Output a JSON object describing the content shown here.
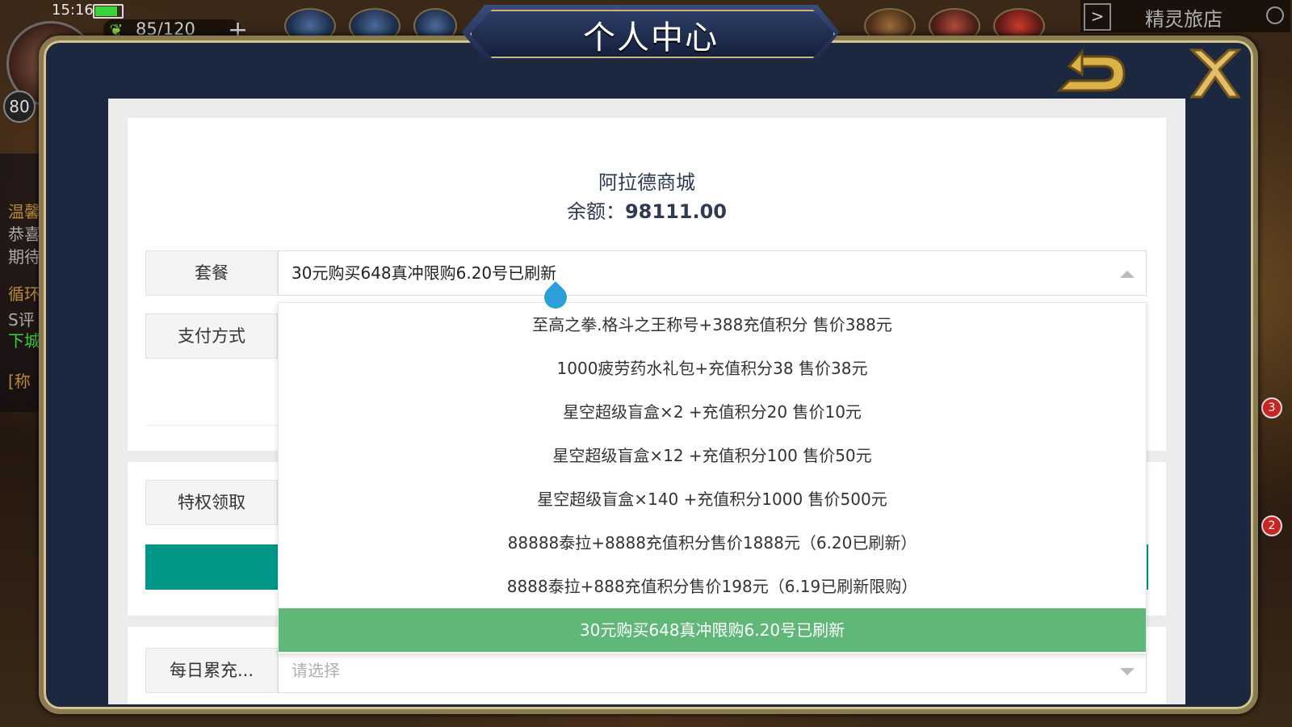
{
  "status_bar": {
    "time": "15:16",
    "energy": "85/120",
    "level": "80"
  },
  "top_right": {
    "shop_label": "精灵旅店"
  },
  "side_panel": {
    "lines": [
      "温馨",
      "恭喜",
      "期待",
      "循环",
      "S评",
      "下城",
      "[称"
    ]
  },
  "badges": [
    "3",
    "2"
  ],
  "modal": {
    "title": "个人中心",
    "shop_name": "阿拉德商城",
    "balance_label": "余额：",
    "balance_value": "98111.00"
  },
  "form": {
    "package_label": "套餐",
    "package_value": "30元购买648真冲限购6.20号已刷新",
    "payment_label": "支付方式",
    "privilege_label": "特权领取",
    "daily_label": "每日累充...",
    "daily_placeholder": "请选择"
  },
  "dropdown": {
    "items": [
      "至高之拳.格斗之王称号+388充值积分 售价388元",
      "1000疲劳药水礼包+充值积分38 售价38元",
      "星空超级盲盒×2 +充值积分20 售价10元",
      "星空超级盲盒×12 +充值积分100 售价50元",
      "星空超级盲盒×140 +充值积分1000 售价500元",
      "88888泰拉+8888充值积分售价1888元（6.20已刷新）",
      "8888泰拉+888充值积分售价198元（6.19已刷新限购）",
      "30元购买648真冲限购6.20号已刷新"
    ],
    "selected_index": 7
  },
  "colors": {
    "frame": "#1c2740",
    "gold": "#c9b57a",
    "teal": "#009688",
    "selected": "#5fb878"
  }
}
